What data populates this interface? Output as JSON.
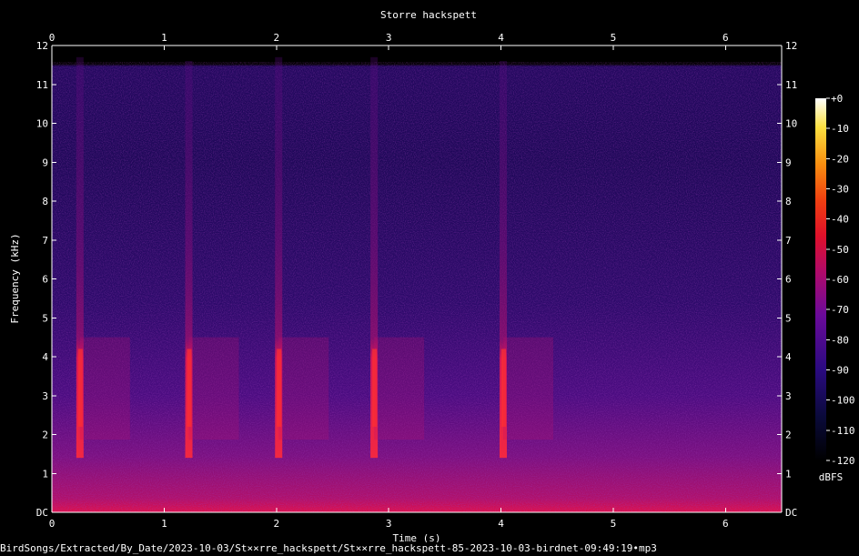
{
  "chart_data": {
    "type": "heatmap",
    "title": "Storre hackspett",
    "xlabel": "Time (s)",
    "ylabel": "Frequency (kHz)",
    "xlim": [
      0,
      6.5
    ],
    "ylim": [
      0,
      12
    ],
    "x_ticks": [
      "0",
      "1",
      "2",
      "3",
      "4",
      "5",
      "6"
    ],
    "y_ticks": [
      "DC",
      "1",
      "2",
      "3",
      "4",
      "5",
      "6",
      "7",
      "8",
      "9",
      "10",
      "11",
      "12"
    ],
    "colorbar": {
      "label": "dBFS",
      "range": [
        -120,
        0
      ],
      "ticks": [
        "+0",
        "-10",
        "-20",
        "-30",
        "-40",
        "-50",
        "-60",
        "-70",
        "-80",
        "-90",
        "-100",
        "-110",
        "-120"
      ]
    },
    "calls": [
      {
        "time_s": 0.25,
        "freq_low_khz": 1.4,
        "freq_high_khz": 11.7
      },
      {
        "time_s": 1.22,
        "freq_low_khz": 1.4,
        "freq_high_khz": 11.6
      },
      {
        "time_s": 2.02,
        "freq_low_khz": 1.4,
        "freq_high_khz": 11.7
      },
      {
        "time_s": 2.87,
        "freq_low_khz": 1.4,
        "freq_high_khz": 11.7
      },
      {
        "time_s": 4.02,
        "freq_low_khz": 1.4,
        "freq_high_khz": 11.6
      }
    ]
  },
  "footer": {
    "filepath": "BirdSongs/Extracted/By_Date/2023-10-03/St××rre_hackspett/St××rre_hackspett-85-2023-10-03-birdnet-09:49:19•mp3"
  }
}
